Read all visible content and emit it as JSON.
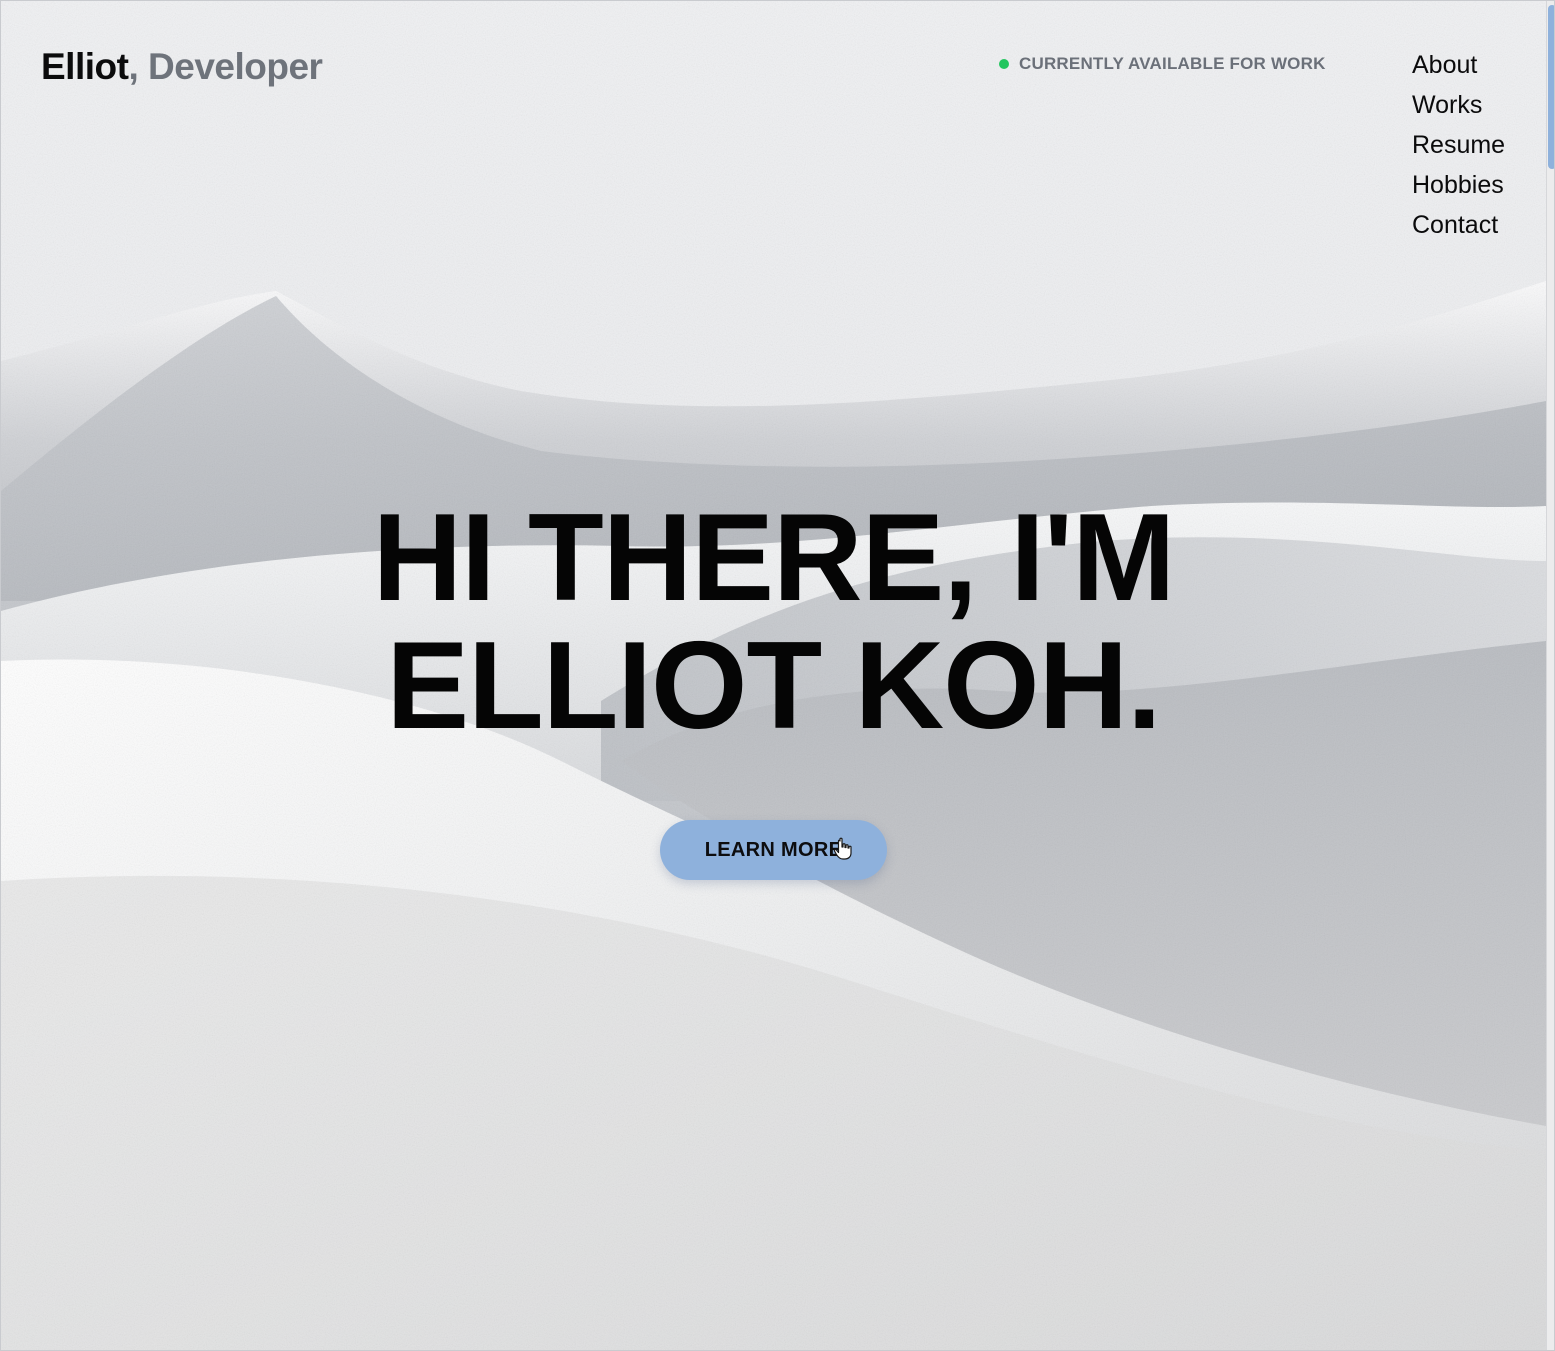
{
  "header": {
    "brand_name": "Elliot",
    "brand_separator": ",",
    "brand_role": "Developer",
    "status_text": "CURRENTLY AVAILABLE FOR WORK",
    "status_color": "#22c55e"
  },
  "nav": {
    "items": [
      {
        "label": "About"
      },
      {
        "label": "Works"
      },
      {
        "label": "Resume"
      },
      {
        "label": "Hobbies"
      },
      {
        "label": "Contact"
      }
    ]
  },
  "hero": {
    "line1": "HI THERE, I'M",
    "line2": "ELLIOT KOH.",
    "cta_label": "LEARN MORE",
    "cta_color": "#8eb1dc"
  },
  "background": {
    "description_icon": "sand-dunes-image"
  }
}
